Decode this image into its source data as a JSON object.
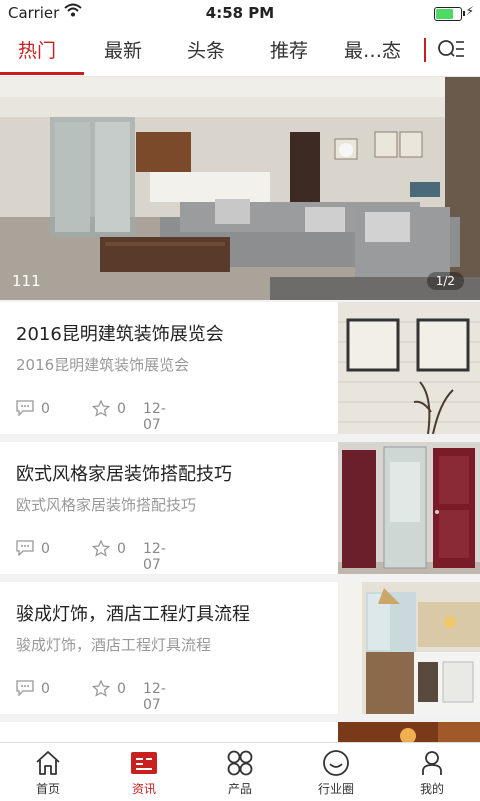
{
  "status_bar": {
    "carrier": "Carrier",
    "time": "4:58 PM"
  },
  "top_tabs": [
    {
      "label": "热门",
      "active": true
    },
    {
      "label": "最新",
      "active": false
    },
    {
      "label": "头条",
      "active": false
    },
    {
      "label": "推荐",
      "active": false
    },
    {
      "label": "最…态",
      "active": false
    }
  ],
  "banner": {
    "caption": "111",
    "pager": "1/2"
  },
  "news": [
    {
      "title": "2016昆明建筑装饰展览会",
      "summary": "2016昆明建筑装饰展览会",
      "comments": "0",
      "stars": "0",
      "date": "12-07"
    },
    {
      "title": "欧式风格家居装饰搭配技巧",
      "summary": "欧式风格家居装饰搭配技巧",
      "comments": "0",
      "stars": "0",
      "date": "12-07"
    },
    {
      "title": "骏成灯饰，酒店工程灯具流程",
      "summary": "骏成灯饰，酒店工程灯具流程",
      "comments": "0",
      "stars": "0",
      "date": "12-07"
    }
  ],
  "bottom_tabs": [
    {
      "label": "首页",
      "icon": "home-icon",
      "active": false
    },
    {
      "label": "资讯",
      "icon": "news-icon",
      "active": true
    },
    {
      "label": "产品",
      "icon": "grid-icon",
      "active": false
    },
    {
      "label": "行业圈",
      "icon": "smile-icon",
      "active": false
    },
    {
      "label": "我的",
      "icon": "user-icon",
      "active": false
    }
  ],
  "colors": {
    "accent": "#c81f1f",
    "text": "#222222",
    "muted": "#999999"
  }
}
